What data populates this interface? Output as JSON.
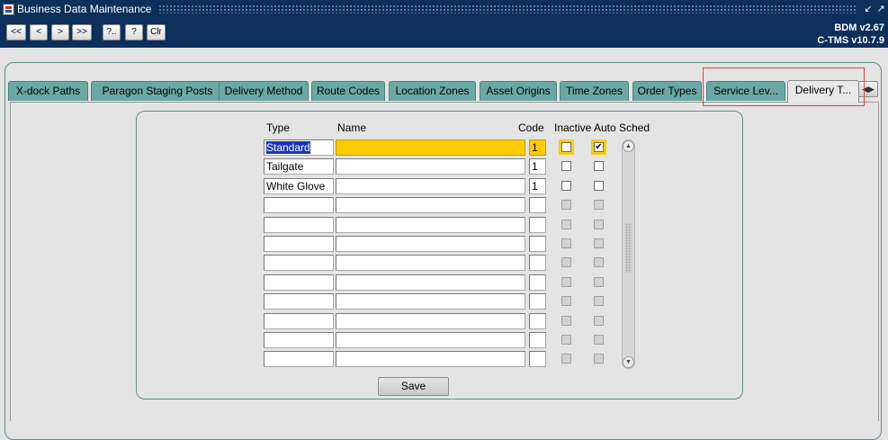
{
  "window": {
    "title": "Business Data Maintenance",
    "version_line1": "BDM v2.67",
    "version_line2": "C-TMS v10.7.9"
  },
  "toolbar": {
    "first_label": "<<",
    "prev_label": "<",
    "next_label": ">",
    "last_label": ">>",
    "query_label": "?..",
    "help_label": "?",
    "clear_label": "Clr"
  },
  "tabs": [
    {
      "label": "X-dock Paths"
    },
    {
      "label": "Paragon Staging Posts"
    },
    {
      "label": "Delivery Method"
    },
    {
      "label": "Route Codes"
    },
    {
      "label": "Location Zones"
    },
    {
      "label": "Asset Origins"
    },
    {
      "label": "Time Zones"
    },
    {
      "label": "Order Types"
    },
    {
      "label": "Service Lev..."
    },
    {
      "label": "Delivery T..."
    }
  ],
  "grid": {
    "headers": {
      "type": "Type",
      "name": "Name",
      "code": "Code",
      "inactive": "Inactive",
      "auto_sched": "Auto Sched"
    },
    "rows": [
      {
        "type": "Standard",
        "name": "",
        "code": "1",
        "inactive": false,
        "auto_sched": true
      },
      {
        "type": "Tailgate",
        "name": "",
        "code": "1",
        "inactive": false,
        "auto_sched": false
      },
      {
        "type": "White Glove",
        "name": "",
        "code": "1",
        "inactive": false,
        "auto_sched": false
      },
      {
        "type": "",
        "name": "",
        "code": "",
        "inactive": false,
        "auto_sched": false
      },
      {
        "type": "",
        "name": "",
        "code": "",
        "inactive": false,
        "auto_sched": false
      },
      {
        "type": "",
        "name": "",
        "code": "",
        "inactive": false,
        "auto_sched": false
      },
      {
        "type": "",
        "name": "",
        "code": "",
        "inactive": false,
        "auto_sched": false
      },
      {
        "type": "",
        "name": "",
        "code": "",
        "inactive": false,
        "auto_sched": false
      },
      {
        "type": "",
        "name": "",
        "code": "",
        "inactive": false,
        "auto_sched": false
      },
      {
        "type": "",
        "name": "",
        "code": "",
        "inactive": false,
        "auto_sched": false
      },
      {
        "type": "",
        "name": "",
        "code": "",
        "inactive": false,
        "auto_sched": false
      },
      {
        "type": "",
        "name": "",
        "code": "",
        "inactive": false,
        "auto_sched": false
      }
    ]
  },
  "buttons": {
    "save_label": "Save"
  }
}
